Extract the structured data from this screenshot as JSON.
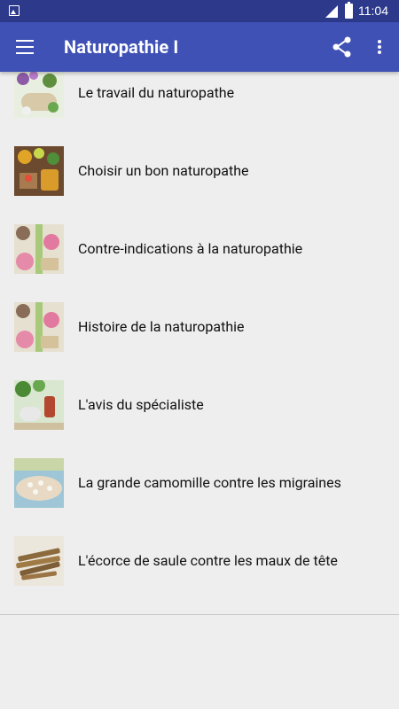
{
  "status_bar": {
    "time": "11:04",
    "icons": [
      "image-notification-icon",
      "signal-icon",
      "battery-charging-icon"
    ]
  },
  "toolbar": {
    "title": "Naturopathie I",
    "icons": [
      "menu-icon",
      "share-icon",
      "more-vert-icon"
    ]
  },
  "colors": {
    "status_bar": "#2d3a8c",
    "toolbar": "#3f51b5",
    "background": "#eeeeee"
  },
  "list": {
    "items": [
      {
        "label": "Le travail du naturopathe"
      },
      {
        "label": "Choisir un bon naturopathe"
      },
      {
        "label": "Contre-indications à la naturopathie"
      },
      {
        "label": "Histoire de la naturopathie"
      },
      {
        "label": "L'avis du spécialiste"
      },
      {
        "label": "La grande camomille contre les migraines"
      },
      {
        "label": "L'écorce de saule contre les maux de tête"
      }
    ]
  }
}
